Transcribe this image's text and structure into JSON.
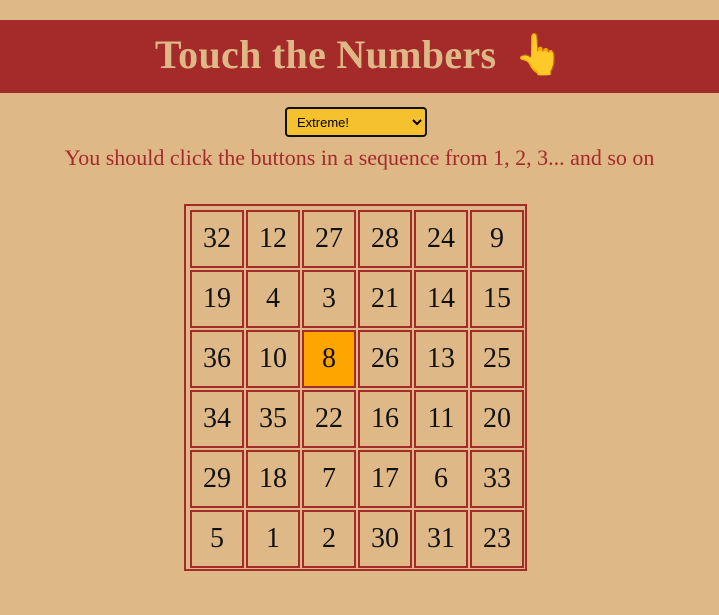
{
  "header": {
    "title": "Touch the Numbers",
    "icon": "pointing-hand-icon",
    "background": "#a52a2a",
    "text_color": "#deb887"
  },
  "level_select": {
    "selected": "Extreme!",
    "background": "#f5c12f"
  },
  "instructions": "You should click the buttons in a sequence from 1, 2, 3... and so on",
  "grid": {
    "rows": [
      [
        "32",
        "12",
        "27",
        "28",
        "24",
        "9"
      ],
      [
        "19",
        "4",
        "3",
        "21",
        "14",
        "15"
      ],
      [
        "36",
        "10",
        "8",
        "26",
        "13",
        "25"
      ],
      [
        "34",
        "35",
        "22",
        "16",
        "11",
        "20"
      ],
      [
        "29",
        "18",
        "7",
        "17",
        "6",
        "33"
      ],
      [
        "5",
        "1",
        "2",
        "30",
        "31",
        "23"
      ]
    ],
    "highlighted_value": "8",
    "highlight_color": "#ffa500"
  }
}
